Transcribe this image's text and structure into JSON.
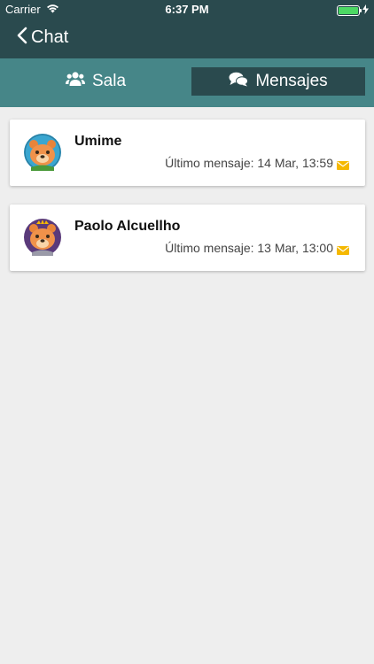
{
  "status_bar": {
    "carrier": "Carrier",
    "time": "6:37 PM"
  },
  "nav": {
    "back_label": "Chat"
  },
  "tabs": [
    {
      "label": "Sala",
      "icon": "users-icon",
      "active": false
    },
    {
      "label": "Mensajes",
      "icon": "chat-bubbles-icon",
      "active": true
    }
  ],
  "conversations": [
    {
      "name": "Umime",
      "last_message": "Último mensaje: 14 Mar, 13:59",
      "avatar_color": "#3aa6d0"
    },
    {
      "name": "Paolo Alcuellho",
      "last_message": "Último mensaje: 13 Mar, 13:00",
      "avatar_color": "#5a3a7a"
    }
  ],
  "colors": {
    "header": "#2a4a4e",
    "tab_bar": "#468688",
    "background": "#eeeeee",
    "mail_icon": "#f5b800"
  }
}
